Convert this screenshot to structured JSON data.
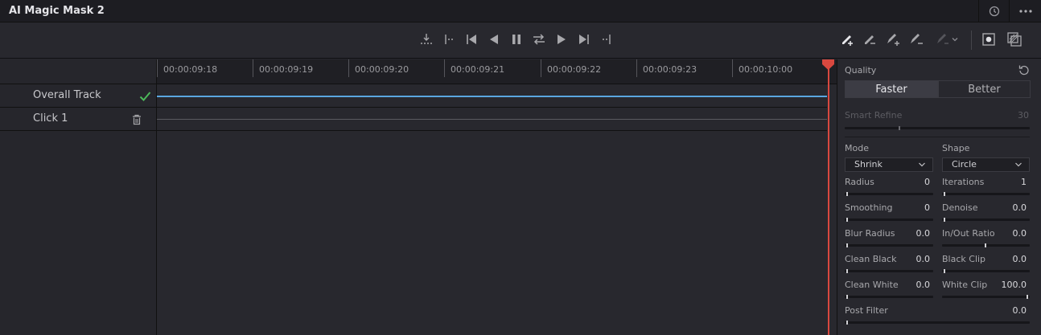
{
  "window": {
    "title": "AI Magic Mask 2"
  },
  "toolbar": {
    "transport": [
      "track-backward-frame-icon",
      "track-to-start-icon",
      "jump-to-start-icon",
      "play-reverse-icon",
      "pause-icon",
      "loop-icon",
      "play-forward-icon",
      "jump-to-end-icon",
      "track-to-end-icon"
    ],
    "tools": [
      "add-mask-pen-icon",
      "remove-mask-pen-icon",
      "add-refine-pen-icon",
      "remove-refine-pen-icon",
      "paint-mode-icon"
    ],
    "views": [
      "overlay-toggle-icon",
      "mask-view-icon"
    ]
  },
  "ruler": {
    "timecodes": [
      "00:00:09:18",
      "00:00:09:19",
      "00:00:09:20",
      "00:00:09:21",
      "00:00:09:22",
      "00:00:09:23",
      "00:00:10:00"
    ]
  },
  "tracks": [
    {
      "label": "Overall Track",
      "icon": "check-icon",
      "color": "#5aa6e0"
    },
    {
      "label": "Click 1",
      "icon": "trash-icon",
      "color": "#5a5a60"
    }
  ],
  "panel": {
    "quality_label": "Quality",
    "quality_options": [
      "Faster",
      "Better"
    ],
    "quality_selected": "Faster",
    "smart_refine": {
      "label": "Smart Refine",
      "value": "30"
    },
    "mode": {
      "label": "Mode",
      "value": "Shrink"
    },
    "shape": {
      "label": "Shape",
      "value": "Circle"
    },
    "params": [
      {
        "label": "Radius",
        "value": "0"
      },
      {
        "label": "Iterations",
        "value": "1"
      },
      {
        "label": "Smoothing",
        "value": "0"
      },
      {
        "label": "Denoise",
        "value": "0.0"
      },
      {
        "label": "Blur Radius",
        "value": "0.0"
      },
      {
        "label": "In/Out Ratio",
        "value": "0.0"
      },
      {
        "label": "Clean Black",
        "value": "0.0"
      },
      {
        "label": "Black Clip",
        "value": "0.0"
      },
      {
        "label": "Clean White",
        "value": "0.0"
      },
      {
        "label": "White Clip",
        "value": "100.0"
      }
    ],
    "post_filter": {
      "label": "Post Filter",
      "value": "0.0"
    }
  }
}
